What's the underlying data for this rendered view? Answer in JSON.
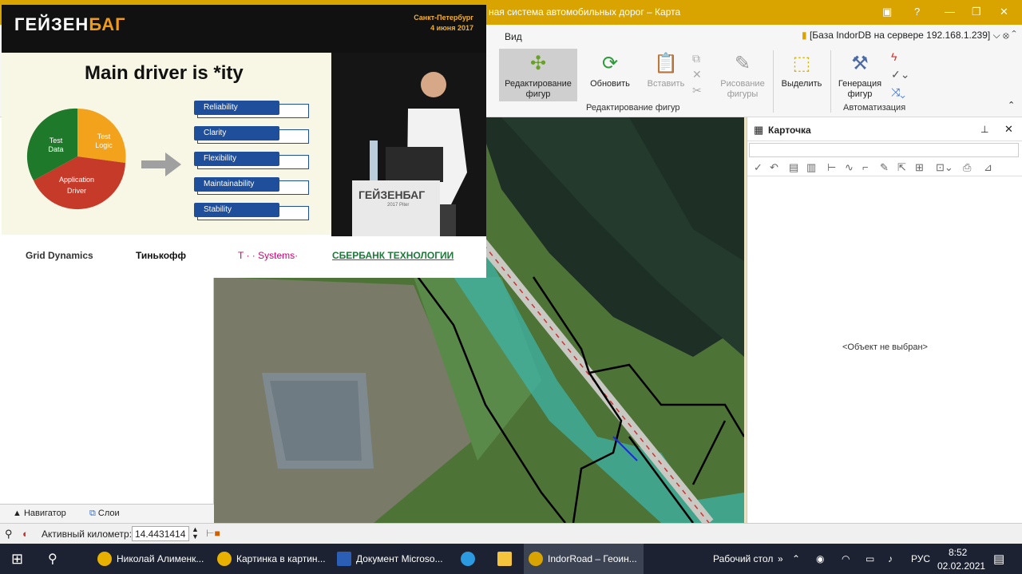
{
  "window": {
    "title": "ная система автомобильных дорог – Карта",
    "db_info": "[База IndorDB на сервере 192.168.1.239]"
  },
  "ribbon": {
    "tab_view": "Вид",
    "btn_edit_figures": "Редактирование фигур",
    "btn_refresh": "Обновить",
    "btn_paste": "Вставить",
    "btn_draw_figures": "Рисование фигуры",
    "btn_select": "Выделить",
    "btn_generate_figures": "Генерация фигур",
    "group_edit": "Редактирование фигур",
    "group_auto": "Автоматизация"
  },
  "leftpanel": {
    "tab_navigator": "Навигатор",
    "tab_layers": "Слои"
  },
  "card": {
    "title": "Карточка",
    "empty": "<Объект не выбран>"
  },
  "status": {
    "km_label": "Активный километр:",
    "km_value": "14.4431414"
  },
  "video": {
    "logo": "ГЕЙЗЕН",
    "logo_accent": "БАГ",
    "city": "Санкт-Петербург",
    "date": "4 июня 2017",
    "slide_title": "Main driver is *ity",
    "pie": {
      "test_data": "Test Data",
      "test_logic": "Test Logic",
      "app_driver": "Application Driver"
    },
    "items": [
      "Reliability",
      "Clarity",
      "Flexibility",
      "Maintainability",
      "Stability"
    ],
    "podium_logo": "ГЕЙЗЕНБАГ",
    "podium_sub": "2017 Piter",
    "sponsors": [
      "Grid Dynamics",
      "Тинькофф",
      "T · · Systems·",
      "СБЕРБАНК ТЕХНОЛОГИИ"
    ]
  },
  "taskbar": {
    "items": [
      "Николай Алименк...",
      "Картинка в картин...",
      "Документ Microso...",
      "",
      "",
      "IndorRoad – Геоин..."
    ],
    "desktop": "Рабочий стол",
    "lang": "РУС",
    "time": "8:52",
    "date": "02.02.2021"
  },
  "colors": {
    "titlebar": "#d9a400",
    "taskbar": "#1c2231",
    "accent_orange": "#f09a18",
    "slide_blue": "#1f4e9a"
  }
}
